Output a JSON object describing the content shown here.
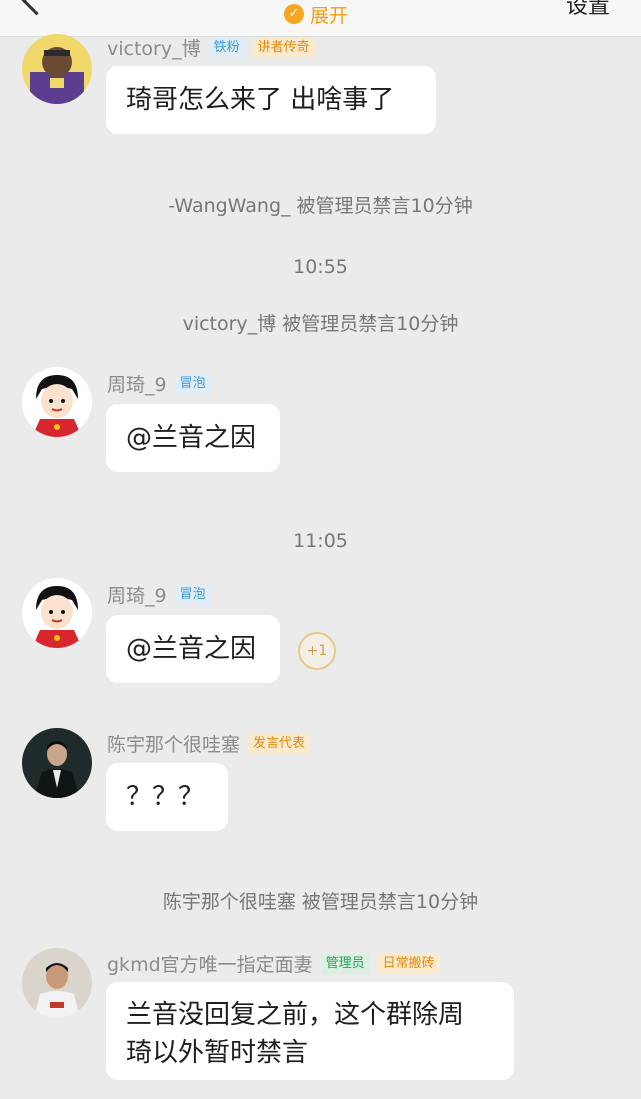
{
  "topbar": {
    "expand_label": "展开",
    "settings_label": "设置"
  },
  "messages": [
    {
      "sender": "victory_博",
      "badges": [
        {
          "text": "铁粉",
          "color": "#3c9bd8"
        },
        {
          "text": "讲者传奇",
          "color": "#e38a12"
        }
      ],
      "text": "琦哥怎么来了 出啥事了"
    },
    {
      "sender": "周琦_9",
      "badges": [
        {
          "text": "冒泡",
          "color": "#3c9bd8"
        }
      ],
      "text": "@兰音之因"
    },
    {
      "sender": "周琦_9",
      "badges": [
        {
          "text": "冒泡",
          "color": "#3c9bd8"
        }
      ],
      "text": "@兰音之因",
      "reaction": "+1"
    },
    {
      "sender": "陈宇那个很哇塞",
      "badges": [
        {
          "text": "发言代表",
          "color": "#e38a12"
        }
      ],
      "text": "？？？"
    },
    {
      "sender": "gkmd官方唯一指定面妻",
      "badges": [
        {
          "text": "管理员",
          "color": "#2aa15b"
        },
        {
          "text": "日常搬砖",
          "color": "#e38a12"
        }
      ],
      "text_lines": [
        "兰音没回复之前，这个群除周",
        "琦以外暂时禁言"
      ]
    }
  ],
  "system": {
    "mute_wangwang": "-WangWang_ 被管理员禁言10分钟",
    "time_1": "10:55",
    "mute_victory": "victory_博 被管理员禁言10分钟",
    "time_2": "11:05",
    "mute_chenyu": "陈宇那个很哇塞 被管理员禁言10分钟"
  }
}
